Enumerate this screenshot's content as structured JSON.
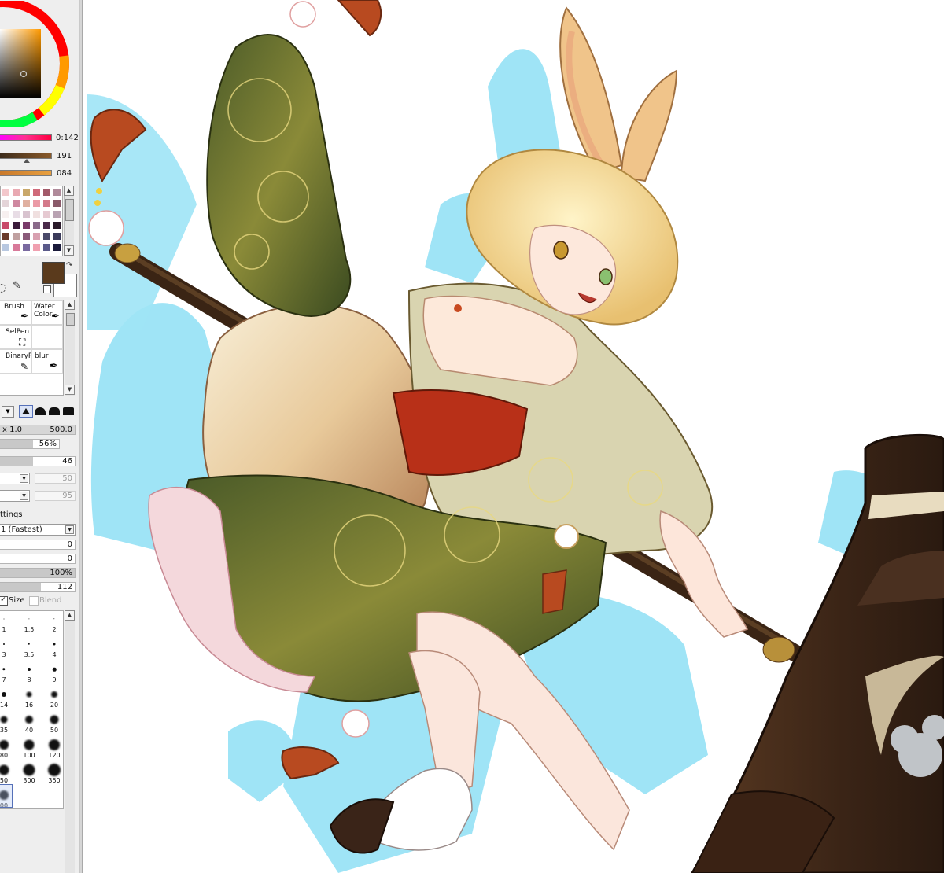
{
  "color": {
    "hue_value": "0:142",
    "slider2_value": "191",
    "slider3_value": "084",
    "primary": "#5a3a1c",
    "secondary": "#ffffff"
  },
  "swatches": [
    "#f3c8cc",
    "#e9a9b2",
    "#c9a86a",
    "#d06a7a",
    "#a35a6a",
    "#b08a9a",
    "#e4d4d8",
    "#cf88a0",
    "#e0b0a0",
    "#eb9aa6",
    "#d47a8a",
    "#8a5a6a",
    "#f7f0f0",
    "#e8dde6",
    "#d8c3cf",
    "#f0e0e0",
    "#e6cad2",
    "#b9a3b3",
    "#c84a6a",
    "#3a1a3a",
    "#7a3a6a",
    "#8a6a8a",
    "#4a2a4a",
    "#2a1a2a",
    "#6a3a2a",
    "#c0a0a0",
    "#8a5a7a",
    "#d8a0b0",
    "#4a4a6a",
    "#3a3a5a",
    "#b8c8e0",
    "#d87a9a",
    "#7a6aa0",
    "#f0a0b0",
    "#5a5a8a",
    "#1a1a3a"
  ],
  "tools": {
    "brush": "Brush",
    "water_color": "Water Color",
    "sel_pen": "SelPen",
    "binary_pen": "BinaryPen",
    "blur": "blur"
  },
  "brush": {
    "size_mult": "x 1.0",
    "size_value": "500.0",
    "density": "56%",
    "density_fill": 0.56,
    "param3": "46",
    "param4": "50",
    "param5": "95",
    "settings_label": "ttings",
    "quality": "1 (Fastest)",
    "edge_hardness": "0",
    "min_density": "0",
    "max_density": "100%",
    "pressure": "112",
    "size_checkbox": "Size",
    "blend_checkbox": "Blend"
  },
  "brush_sizes": [
    "1",
    "1.5",
    "2",
    "3",
    "3.5",
    "4",
    "7",
    "8",
    "9",
    "14",
    "16",
    "20",
    "35",
    "40",
    "50",
    "80",
    "100",
    "120",
    "50",
    "300",
    "350",
    "00"
  ]
}
